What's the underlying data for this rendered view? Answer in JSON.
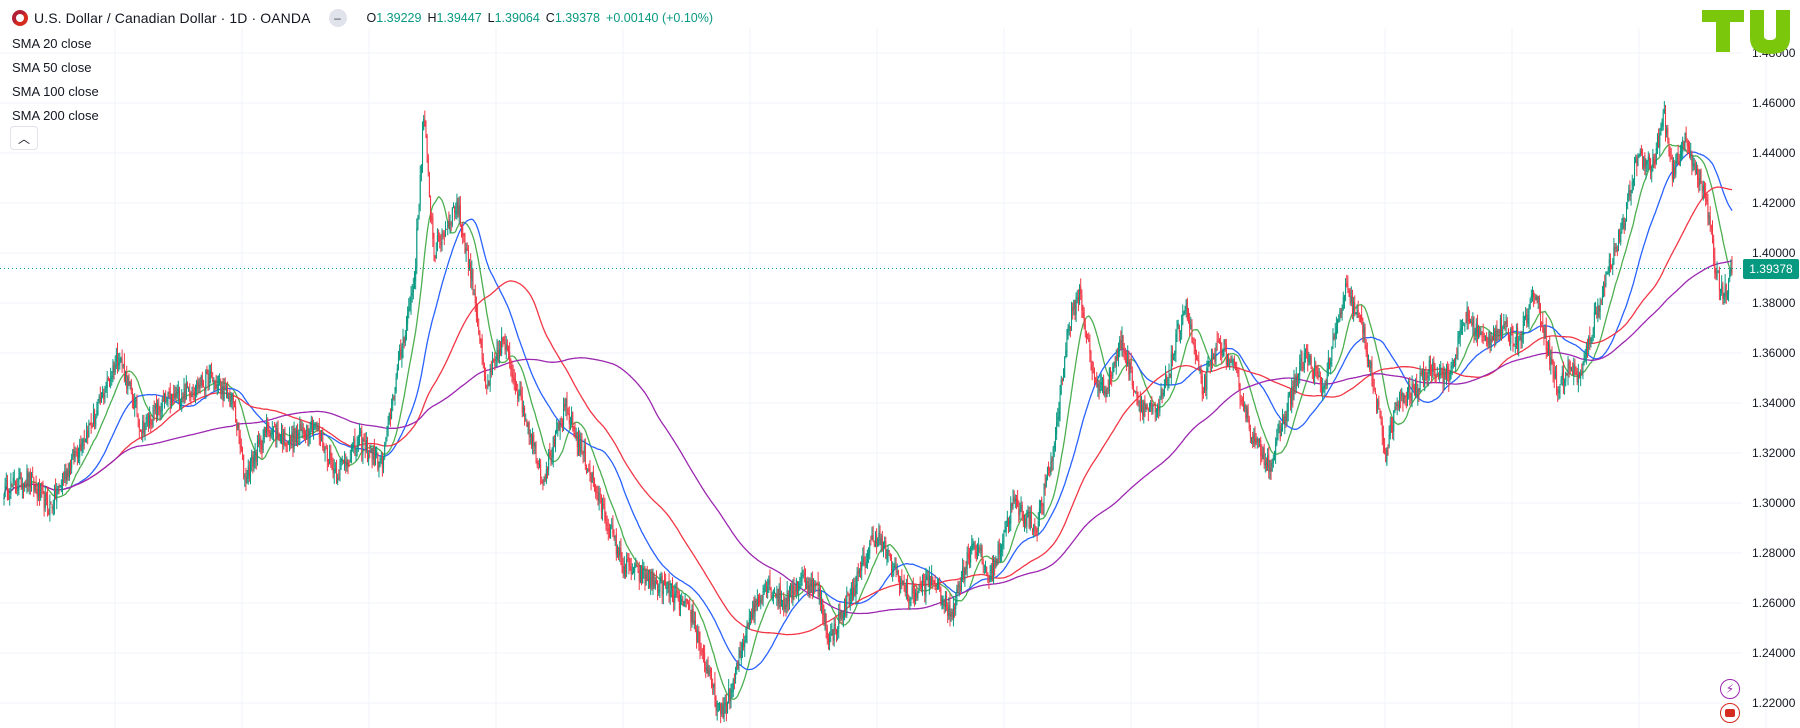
{
  "header": {
    "title": "U.S. Dollar / Canadian Dollar · 1D · OANDA",
    "ohlc": {
      "o_label": "O",
      "o_value": "1.39229",
      "h_label": "H",
      "h_value": "1.39447",
      "l_label": "L",
      "l_value": "1.39064",
      "c_label": "C",
      "c_value": "1.39378",
      "change": "+0.00140 (+0.10%)"
    },
    "collapse_icon": "minus-icon"
  },
  "indicators": [
    {
      "label": "SMA 20 close",
      "color": "#4caf50"
    },
    {
      "label": "SMA 50 close",
      "color": "#2962ff"
    },
    {
      "label": "SMA 100 close",
      "color": "#f23645"
    },
    {
      "label": "SMA 200 close",
      "color": "#9c27b0"
    }
  ],
  "legend_toggle_icon": "chevron-up-icon",
  "logo_text": "TU",
  "logo_color": "#7ac70c",
  "last_price_label": "1.39378",
  "colors": {
    "up": "#089981",
    "down": "#f23645",
    "grid": "#f0f3fa",
    "axis_text": "#131722"
  },
  "side_icons": [
    "lightning-icon",
    "canadian-flag-icon"
  ],
  "chart_data": {
    "type": "candlestick",
    "symbol": "USDCAD",
    "interval": "1D",
    "ylim": [
      1.21,
      1.49
    ],
    "y_ticks": [
      "1.48000",
      "1.46000",
      "1.44000",
      "1.42000",
      "1.40000",
      "1.38000",
      "1.36000",
      "1.34000",
      "1.32000",
      "1.30000",
      "1.28000",
      "1.26000",
      "1.24000",
      "1.22000"
    ],
    "last_price": 1.39378,
    "bars": 780,
    "price_path": [
      [
        0,
        1.305
      ],
      [
        20,
        1.31
      ],
      [
        40,
        1.298
      ],
      [
        60,
        1.318
      ],
      [
        80,
        1.335
      ],
      [
        100,
        1.36
      ],
      [
        120,
        1.33
      ],
      [
        140,
        1.34
      ],
      [
        160,
        1.345
      ],
      [
        180,
        1.35
      ],
      [
        200,
        1.34
      ],
      [
        210,
        1.31
      ],
      [
        230,
        1.33
      ],
      [
        250,
        1.325
      ],
      [
        270,
        1.332
      ],
      [
        290,
        1.312
      ],
      [
        310,
        1.325
      ],
      [
        330,
        1.315
      ],
      [
        340,
        1.345
      ],
      [
        358,
        1.39
      ],
      [
        366,
        1.455
      ],
      [
        375,
        1.4
      ],
      [
        395,
        1.42
      ],
      [
        410,
        1.385
      ],
      [
        420,
        1.345
      ],
      [
        435,
        1.365
      ],
      [
        455,
        1.335
      ],
      [
        470,
        1.31
      ],
      [
        490,
        1.338
      ],
      [
        505,
        1.32
      ],
      [
        520,
        1.3
      ],
      [
        540,
        1.275
      ],
      [
        560,
        1.27
      ],
      [
        580,
        1.265
      ],
      [
        600,
        1.255
      ],
      [
        615,
        1.23
      ],
      [
        625,
        1.215
      ],
      [
        635,
        1.225
      ],
      [
        650,
        1.255
      ],
      [
        665,
        1.268
      ],
      [
        680,
        1.26
      ],
      [
        695,
        1.27
      ],
      [
        710,
        1.265
      ],
      [
        720,
        1.245
      ],
      [
        730,
        1.255
      ],
      [
        745,
        1.27
      ],
      [
        760,
        1.288
      ],
      [
        775,
        1.275
      ],
      [
        790,
        1.262
      ],
      [
        810,
        1.27
      ],
      [
        825,
        1.255
      ],
      [
        845,
        1.285
      ],
      [
        860,
        1.27
      ],
      [
        880,
        1.3
      ],
      [
        900,
        1.29
      ],
      [
        915,
        1.32
      ],
      [
        928,
        1.37
      ],
      [
        938,
        1.385
      ],
      [
        950,
        1.35
      ],
      [
        960,
        1.345
      ],
      [
        975,
        1.365
      ],
      [
        990,
        1.34
      ],
      [
        1005,
        1.335
      ],
      [
        1015,
        1.35
      ],
      [
        1030,
        1.38
      ],
      [
        1045,
        1.345
      ],
      [
        1060,
        1.365
      ],
      [
        1075,
        1.35
      ],
      [
        1090,
        1.325
      ],
      [
        1105,
        1.315
      ],
      [
        1120,
        1.34
      ],
      [
        1135,
        1.36
      ],
      [
        1150,
        1.345
      ],
      [
        1170,
        1.385
      ],
      [
        1185,
        1.37
      ],
      [
        1195,
        1.345
      ],
      [
        1205,
        1.32
      ],
      [
        1215,
        1.34
      ],
      [
        1230,
        1.345
      ],
      [
        1245,
        1.355
      ],
      [
        1260,
        1.35
      ],
      [
        1275,
        1.375
      ],
      [
        1290,
        1.365
      ],
      [
        1305,
        1.37
      ],
      [
        1320,
        1.365
      ],
      [
        1335,
        1.385
      ],
      [
        1345,
        1.365
      ],
      [
        1355,
        1.345
      ],
      [
        1365,
        1.355
      ],
      [
        1375,
        1.35
      ],
      [
        1385,
        1.37
      ],
      [
        1400,
        1.395
      ],
      [
        1412,
        1.41
      ],
      [
        1425,
        1.44
      ],
      [
        1438,
        1.435
      ],
      [
        1448,
        1.455
      ],
      [
        1455,
        1.43
      ],
      [
        1465,
        1.445
      ],
      [
        1475,
        1.435
      ],
      [
        1485,
        1.42
      ],
      [
        1492,
        1.395
      ],
      [
        1500,
        1.383
      ],
      [
        1507,
        1.392
      ]
    ],
    "series": [
      {
        "name": "SMA 20 close",
        "period": 20,
        "color": "#4caf50"
      },
      {
        "name": "SMA 50 close",
        "period": 50,
        "color": "#2962ff"
      },
      {
        "name": "SMA 100 close",
        "period": 100,
        "color": "#f23645"
      },
      {
        "name": "SMA 200 close",
        "period": 200,
        "color": "#9c27b0"
      }
    ],
    "grid": true
  }
}
